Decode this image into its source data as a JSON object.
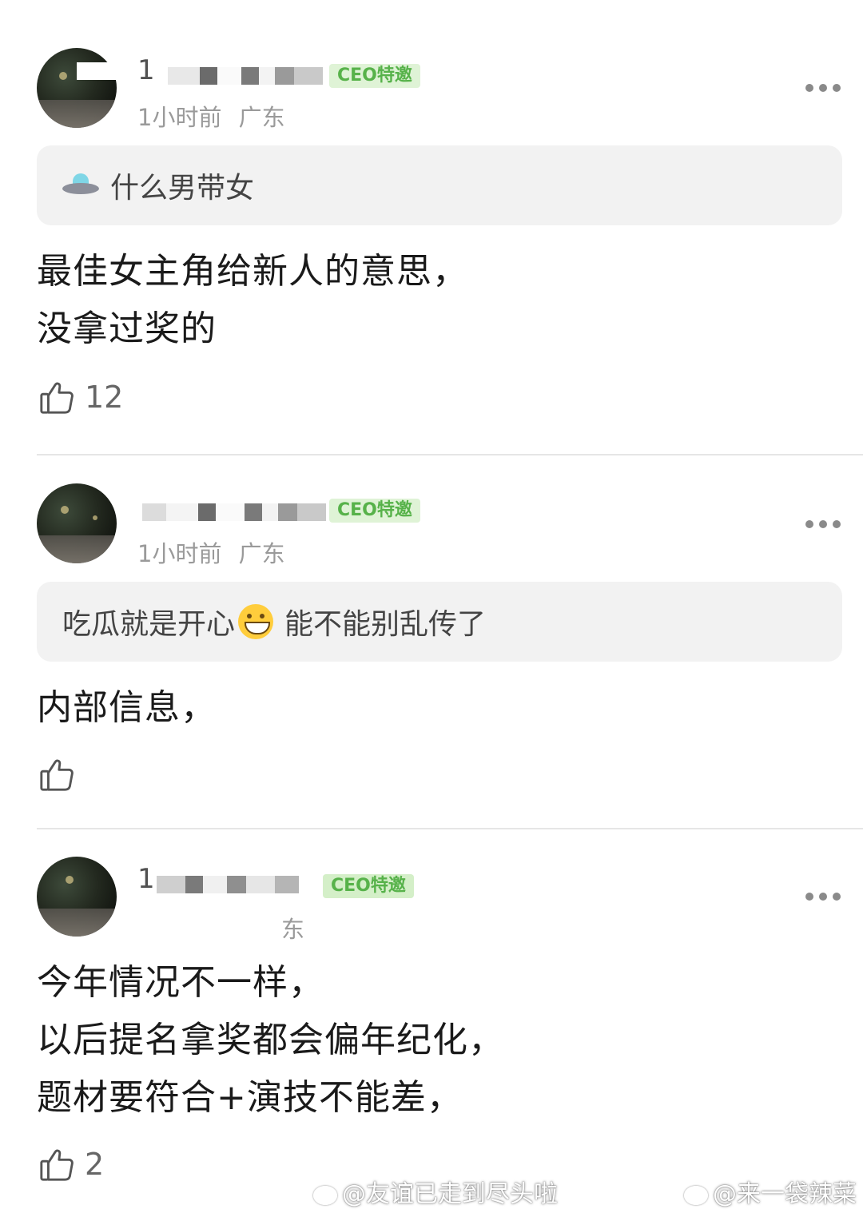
{
  "posts": [
    {
      "username": "1",
      "badge": "CEO特邀",
      "time": "1小时前",
      "location": "广东",
      "quote_text": "什么男带女",
      "quote_icon": "ufo-icon",
      "content_lines": [
        "最佳女主角给新人的意思，",
        "没拿过奖的"
      ],
      "like_count": "12"
    },
    {
      "username": "",
      "badge": "CEO特邀",
      "time": "1小时前",
      "location": "广东",
      "quote_before": "吃瓜就是开心",
      "quote_icon": "grin-emoji",
      "quote_after": "能不能别乱传了",
      "content_lines": [
        "内部信息，"
      ],
      "like_count": ""
    },
    {
      "username": "1",
      "badge": "CEO特邀",
      "time": "",
      "location": "东",
      "content_lines": [
        "今年情况不一样，",
        "以后提名拿奖都会偏年纪化，",
        "题材要符合+演技不能差，"
      ],
      "like_count": "2"
    }
  ],
  "watermarks": [
    "@友谊已走到尽头啦",
    "@来一袋辣菜"
  ],
  "colors": {
    "badge_bg": "#dff3d6",
    "badge_text": "#57b24a",
    "quote_bg": "#f2f2f2",
    "meta": "#9a9a9a"
  }
}
